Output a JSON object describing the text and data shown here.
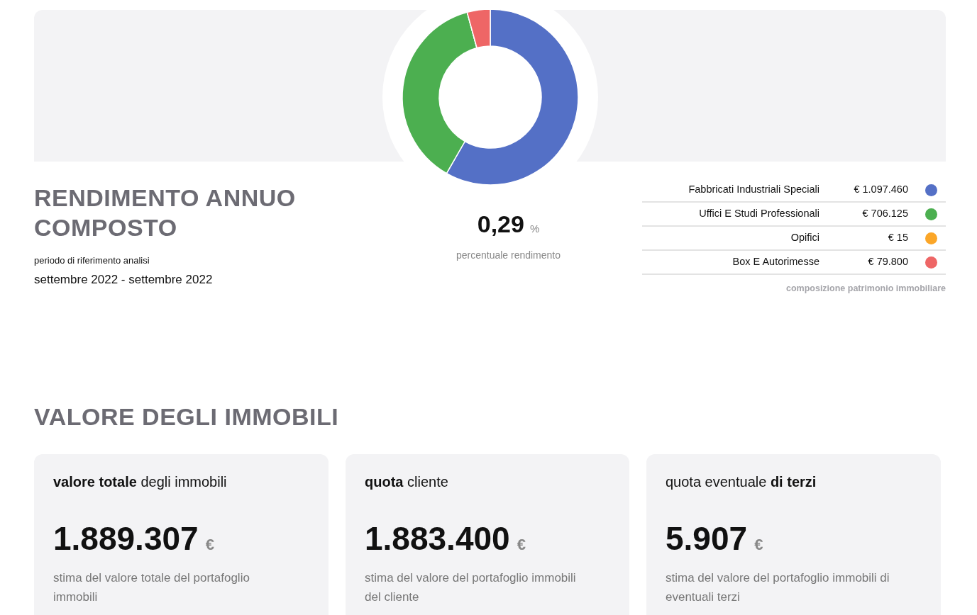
{
  "performance": {
    "title": "RENDIMENTO ANNUO COMPOSTO",
    "period_label": "periodo di riferimento analisi",
    "period": "settembre 2022 - settembre 2022",
    "value": "0,29",
    "unit": "%",
    "caption": "percentuale rendimento"
  },
  "composition": {
    "chart_data": {
      "type": "donut",
      "categories": [
        "Fabbricati Industriali Speciali",
        "Uffici E Studi Professionali",
        "Opifici",
        "Box E Autorimesse"
      ],
      "values": [
        58.2702,
        37.492,
        null,
        4.237
      ]
    },
    "legend": [
      {
        "amount": "€ 1.097.460",
        "color": "#5470c6"
      },
      {
        "amount": "€ 706.125",
        "color": "#4caf50"
      },
      {
        "amount": "€ 15",
        "color": "#fba628"
      },
      {
        "amount": "€ 79.800",
        "color": "#ee6666"
      }
    ],
    "caption": "composizione patrimonio immobiliare"
  },
  "property_value": {
    "title": "VALORE DEGLI IMMOBILI",
    "cards": [
      {
        "title": "**valore totale** degli immobili",
        "value": "1.889.307",
        "unit": "€",
        "description": "stima del valore totale del portafoglio immobili"
      },
      {
        "title": "**quota** cliente",
        "value": "1.883.400",
        "unit": "€",
        "description": "stima del valore del portafoglio immobili del cliente"
      },
      {
        "title": "quota eventuale **di terzi**",
        "value": "5.907",
        "unit": "€",
        "description": "stima del valore del portafoglio immobili di eventuali terzi"
      }
    ]
  }
}
